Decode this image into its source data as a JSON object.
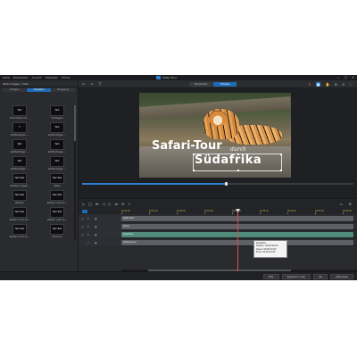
{
  "app": {
    "title": "Safari Tour",
    "menu": [
      "Datei",
      "Bearbeiten",
      "Ansicht",
      "Abspielen",
      "Extras"
    ]
  },
  "window_controls": [
    "—",
    "□",
    "✕"
  ],
  "toolbar": {
    "view_modes": [
      "Storyboard",
      "Timeline"
    ],
    "active_view": "Timeline"
  },
  "left_panel": {
    "title": "Textvorlagen | Titel",
    "tabs": [
      "Vorlagen",
      "Animation",
      "Bewegung"
    ],
    "active_tab": "Animation",
    "tiles": [
      {
        "label": "Einschiebt von...",
        "thumb": "Text"
      },
      {
        "label": "Verbiegen",
        "thumb": "Text"
      },
      {
        "label": "Verflüchtigen ...",
        "thumb": "T"
      },
      {
        "label": "Verflüchtigen ...",
        "thumb": "Text"
      },
      {
        "label": "Verflüchtigen ...",
        "thumb": "Text"
      },
      {
        "label": "Verflüchtigen ...",
        "thumb": "Text"
      },
      {
        "label": "Verflüchtigen ...",
        "thumb": "Text"
      },
      {
        "label": "Verflüchtigen ...",
        "thumb": "Text"
      },
      {
        "label": "Vertikal umgek...",
        "thumb": "Text Text"
      },
      {
        "label": "Welle",
        "thumb": "Text Text"
      },
      {
        "label": "Wirbeln",
        "thumb": "Text Text"
      },
      {
        "label": "Ziehen nach lin...",
        "thumb": "Text Text"
      },
      {
        "label": "Ziehen nach ob...",
        "thumb": "Text Text"
      },
      {
        "label": "Ziehen nach re...",
        "thumb": "Text Text"
      },
      {
        "label": "Ziehen nach un...",
        "thumb": "Text Text"
      },
      {
        "label": "Zoomen",
        "thumb": "Text Text"
      }
    ]
  },
  "preview": {
    "title_line1": "Safari-Tour",
    "title_script": "durch",
    "title_line2": "Südafrika",
    "progress": 0.53
  },
  "timeline": {
    "ruler": [
      "00:00:00",
      "00:01:00",
      "00:02:00",
      "00:03:00",
      "00:04:00",
      "00:05:00",
      "00:06:00",
      "00:07:00",
      "00:08:00"
    ],
    "tracks": [
      {
        "label": "Safari-Tour",
        "color": "#5e6066"
      },
      {
        "label": "durch",
        "color": "#5e6066"
      },
      {
        "label": "Südafrika",
        "color": "#4f8a7a"
      },
      {
        "label": "Hintergrund",
        "color": "#5e6066"
      }
    ],
    "tooltip": [
      "Südafrika",
      "Position: 00:00:00:00",
      "Dauer: 00:00:10:00",
      "Ende: 00:00:10:00"
    ]
  },
  "bottom_bar": {
    "buttons": [
      "Hilfe",
      "Speichern unter",
      "OK",
      "Abbrechen"
    ]
  },
  "colors": {
    "accent": "#2f7fd0",
    "playhead": "#e04b4b",
    "background": "#26272b"
  }
}
